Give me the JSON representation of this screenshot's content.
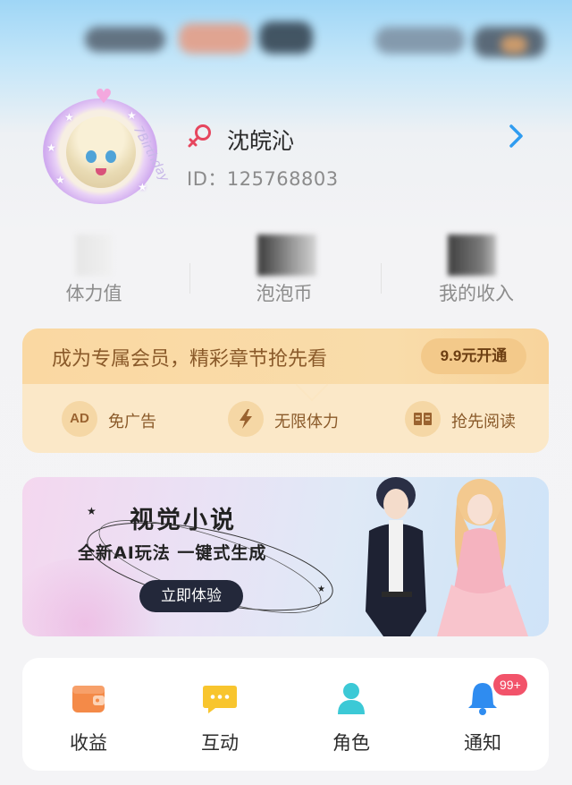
{
  "profile": {
    "username": "沈皖沁",
    "user_id": "ID：125768803",
    "avatar_caption": "7Birthday"
  },
  "stats": [
    {
      "label": "体力值"
    },
    {
      "label": "泡泡币"
    },
    {
      "label": "我的收入"
    }
  ],
  "vip": {
    "title": "成为专属会员，精彩章节抢先看",
    "cta": "9.9元开通",
    "perks": [
      {
        "icon_text": "AD",
        "icon": "no-ads-icon",
        "label": "免广告"
      },
      {
        "icon": "lightning-icon",
        "label": "无限体力"
      },
      {
        "icon": "book-icon",
        "label": "抢先阅读"
      }
    ]
  },
  "banner": {
    "title": "视觉小说",
    "subtitle": "全新AI玩法 一键式生成",
    "cta": "立即体验"
  },
  "grid": [
    {
      "label": "收益",
      "icon": "wallet-icon"
    },
    {
      "label": "互动",
      "icon": "chat-icon"
    },
    {
      "label": "角色",
      "icon": "person-icon"
    },
    {
      "label": "通知",
      "icon": "bell-icon",
      "badge": "99+"
    }
  ],
  "colors": {
    "vip_text": "#8a5a2a",
    "accent_blue": "#2f9cf0",
    "badge_red": "#f2536a",
    "gender_icon": "#e6465e"
  }
}
